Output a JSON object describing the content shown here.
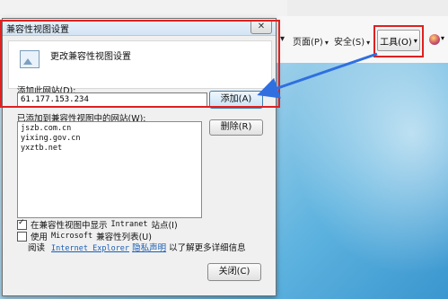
{
  "browser": {
    "menu": [
      {
        "label": "页面(P)",
        "arrow": "▾"
      },
      {
        "label": "安全(S)",
        "arrow": "▾"
      }
    ],
    "tools_label": "工具(O)",
    "tools_arrow": "▾",
    "leading_arrow": "▾",
    "help_arrow": "▾"
  },
  "dialog": {
    "title": "兼容性视图设置",
    "close_glyph": "✕",
    "header": "更改兼容性视图设置",
    "add_label": "添加此网站(D):",
    "add_input_value": "61.177.153.234",
    "add_button": "添加(A)",
    "list_label": "已添加到兼容性视图中的网站(W):",
    "sites": [
      "jszb.com.cn",
      "yixing.gov.cn",
      "yxztb.net"
    ],
    "delete_button": "删除(R)",
    "option1_pre": "在兼容性视图中显示",
    "option1_mono": "Intranet",
    "option1_post": "站点(I)",
    "option1_checked": true,
    "option2_pre": "使用",
    "option2_mono": "Microsoft",
    "option2_post": "兼容性列表(U)",
    "option2_checked": false,
    "read_pre": "阅读",
    "read_link": "Internet Explorer",
    "read_link2": "隐私声明",
    "read_post": "以了解更多详细信息",
    "close_button": "关闭(C)"
  },
  "colors": {
    "annotation_red": "#e02020",
    "annotation_arrow": "#2f6fe0"
  }
}
